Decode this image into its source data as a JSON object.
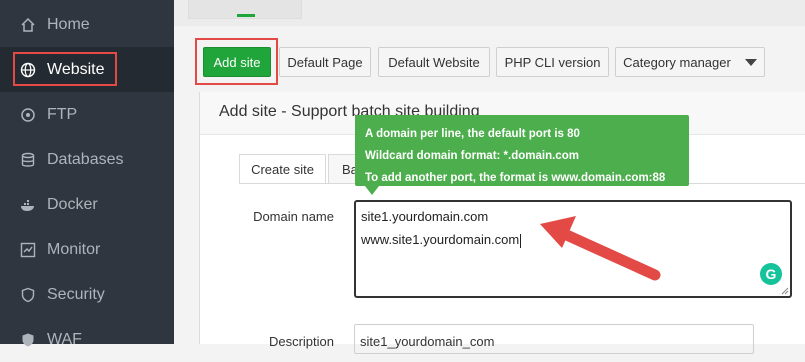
{
  "sidebar": {
    "items": [
      {
        "label": "Home",
        "icon": "home-icon"
      },
      {
        "label": "Website",
        "icon": "globe-icon",
        "active": true
      },
      {
        "label": "FTP",
        "icon": "ftp-icon"
      },
      {
        "label": "Databases",
        "icon": "database-icon"
      },
      {
        "label": "Docker",
        "icon": "docker-icon"
      },
      {
        "label": "Monitor",
        "icon": "monitor-icon"
      },
      {
        "label": "Security",
        "icon": "shield-icon"
      },
      {
        "label": "WAF",
        "icon": "waf-icon"
      }
    ]
  },
  "toolbar": {
    "add_site": "Add site",
    "default_page": "Default Page",
    "default_website": "Default Website",
    "php_cli": "PHP CLI version",
    "category_manager": "Category manager"
  },
  "dialog": {
    "title": "Add site - Support batch site building",
    "tabs": [
      {
        "label": "Create site",
        "active": true
      },
      {
        "label": "Ba",
        "active": false
      }
    ],
    "domain_label": "Domain name",
    "domain_lines": [
      "site1.yourdomain.com",
      "www.site1.yourdomain.com"
    ],
    "description_label": "Description",
    "description_value": "site1_yourdomain_com"
  },
  "tooltip": {
    "lines": [
      "A domain per line, the default port is 80",
      "Wildcard domain format: *.domain.com",
      "To add another port, the format is www.domain.com:88"
    ]
  },
  "colors": {
    "sidebar_bg": "#2f3640",
    "accent_green": "#20a53a",
    "highlight_red": "#e34a45",
    "tooltip_green": "#4cae4c"
  }
}
